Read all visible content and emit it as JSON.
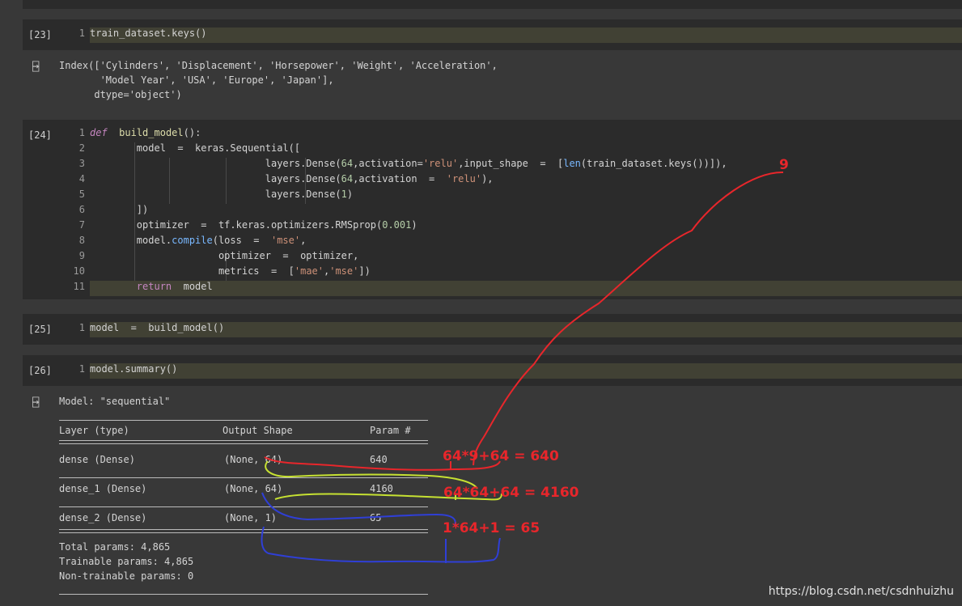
{
  "cells": [
    {
      "label": "[23]",
      "lines": [
        {
          "n": "1",
          "code": "train_dataset.keys()"
        }
      ]
    },
    {
      "label": "[24]",
      "lines": [
        {
          "n": "1",
          "code": "def  build_model():"
        },
        {
          "n": "2",
          "code": "        model  =  keras.Sequential(["
        },
        {
          "n": "3",
          "code": "                              layers.Dense(64,activation='relu',input_shape  =  [len(train_dataset.keys())]),"
        },
        {
          "n": "4",
          "code": "                              layers.Dense(64,activation  =  'relu'),"
        },
        {
          "n": "5",
          "code": "                              layers.Dense(1)"
        },
        {
          "n": "6",
          "code": "        ])"
        },
        {
          "n": "7",
          "code": "        optimizer  =  tf.keras.optimizers.RMSprop(0.001)"
        },
        {
          "n": "8",
          "code": "        model.compile(loss  =  'mse',"
        },
        {
          "n": "9",
          "code": "                      optimizer  =  optimizer,"
        },
        {
          "n": "10",
          "code": "                      metrics  =  ['mae','mse'])"
        },
        {
          "n": "11",
          "code": "        return  model"
        }
      ]
    },
    {
      "label": "[25]",
      "lines": [
        {
          "n": "1",
          "code": "model  =  build_model()"
        }
      ]
    },
    {
      "label": "[26]",
      "lines": [
        {
          "n": "1",
          "code": "model.summary()"
        }
      ]
    }
  ],
  "output23": [
    "Index(['Cylinders', 'Displacement', 'Horsepower', 'Weight', 'Acceleration',",
    "       'Model Year', 'USA', 'Europe', 'Japan'],",
    "      dtype='object')"
  ],
  "summary": {
    "model_line": "Model: \"sequential\"",
    "headers": [
      "Layer (type)",
      "Output Shape",
      "Param #"
    ],
    "rows": [
      [
        "dense (Dense)",
        "(None, 64)",
        "640"
      ],
      [
        "dense_1 (Dense)",
        "(None, 64)",
        "4160"
      ],
      [
        "dense_2 (Dense)",
        "(None, 1)",
        "65"
      ]
    ],
    "total": "Total params: 4,865",
    "trainable": "Trainable params: 4,865",
    "non_trainable": "Non-trainable params: 0"
  },
  "annotations": {
    "nine": "9",
    "eq1": "64*9+64 = 640",
    "eq2": "64*64+64 = 4160",
    "eq3": "1*64+1 = 65"
  },
  "watermark": "https://blog.csdn.net/csdnhuizhu",
  "colors": {
    "red": "#e8262b",
    "yellow": "#c6e132",
    "blue": "#2f3fd6"
  }
}
